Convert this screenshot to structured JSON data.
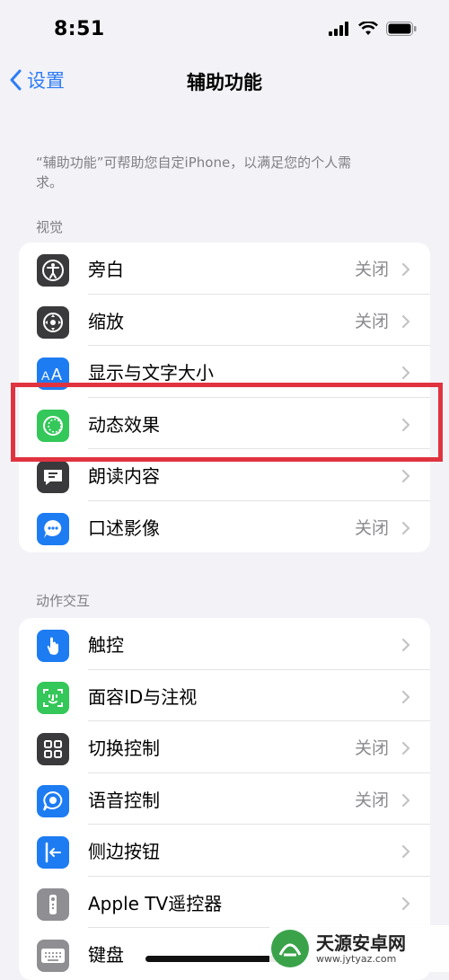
{
  "status_bar": {
    "time": "8:51"
  },
  "nav": {
    "back_label": "设置",
    "title": "辅助功能"
  },
  "intro": "“辅助功能”可帮助您自定iPhone，以满足您的个人需求。",
  "sections": {
    "vision": {
      "header": "视觉",
      "items": [
        {
          "label": "旁白",
          "value": "关闭",
          "icon": "voiceover-icon",
          "icon_color": "#3a3a3c"
        },
        {
          "label": "缩放",
          "value": "关闭",
          "icon": "zoom-icon",
          "icon_color": "#3a3a3c"
        },
        {
          "label": "显示与文字大小",
          "value": "",
          "icon": "text-size-icon",
          "icon_color": "#1e7cf2"
        },
        {
          "label": "动态效果",
          "value": "",
          "icon": "motion-icon",
          "icon_color": "#34c759"
        },
        {
          "label": "朗读内容",
          "value": "",
          "icon": "spoken-content-icon",
          "icon_color": "#3a3a3c"
        },
        {
          "label": "口述影像",
          "value": "关闭",
          "icon": "audio-description-icon",
          "icon_color": "#1e7cf2"
        }
      ]
    },
    "interaction": {
      "header": "动作交互",
      "items": [
        {
          "label": "触控",
          "value": "",
          "icon": "touch-icon",
          "icon_color": "#1e7cf2"
        },
        {
          "label": "面容ID与注视",
          "value": "",
          "icon": "face-id-icon",
          "icon_color": "#34c759"
        },
        {
          "label": "切换控制",
          "value": "关闭",
          "icon": "switch-control-icon",
          "icon_color": "#3a3a3c"
        },
        {
          "label": "语音控制",
          "value": "关闭",
          "icon": "voice-control-icon",
          "icon_color": "#1e7cf2"
        },
        {
          "label": "侧边按钮",
          "value": "",
          "icon": "side-button-icon",
          "icon_color": "#1e7cf2"
        },
        {
          "label": "Apple TV遥控器",
          "value": "",
          "icon": "apple-tv-remote-icon",
          "icon_color": "#8e8e93"
        },
        {
          "label": "键盘",
          "value": "",
          "icon": "keyboard-icon",
          "icon_color": "#8e8e93"
        }
      ]
    }
  },
  "watermark": {
    "name": "天源安卓网",
    "url": "www.jytyaz.com"
  },
  "accent_color": "#2f7cf6",
  "highlight_color": "#e0333f"
}
